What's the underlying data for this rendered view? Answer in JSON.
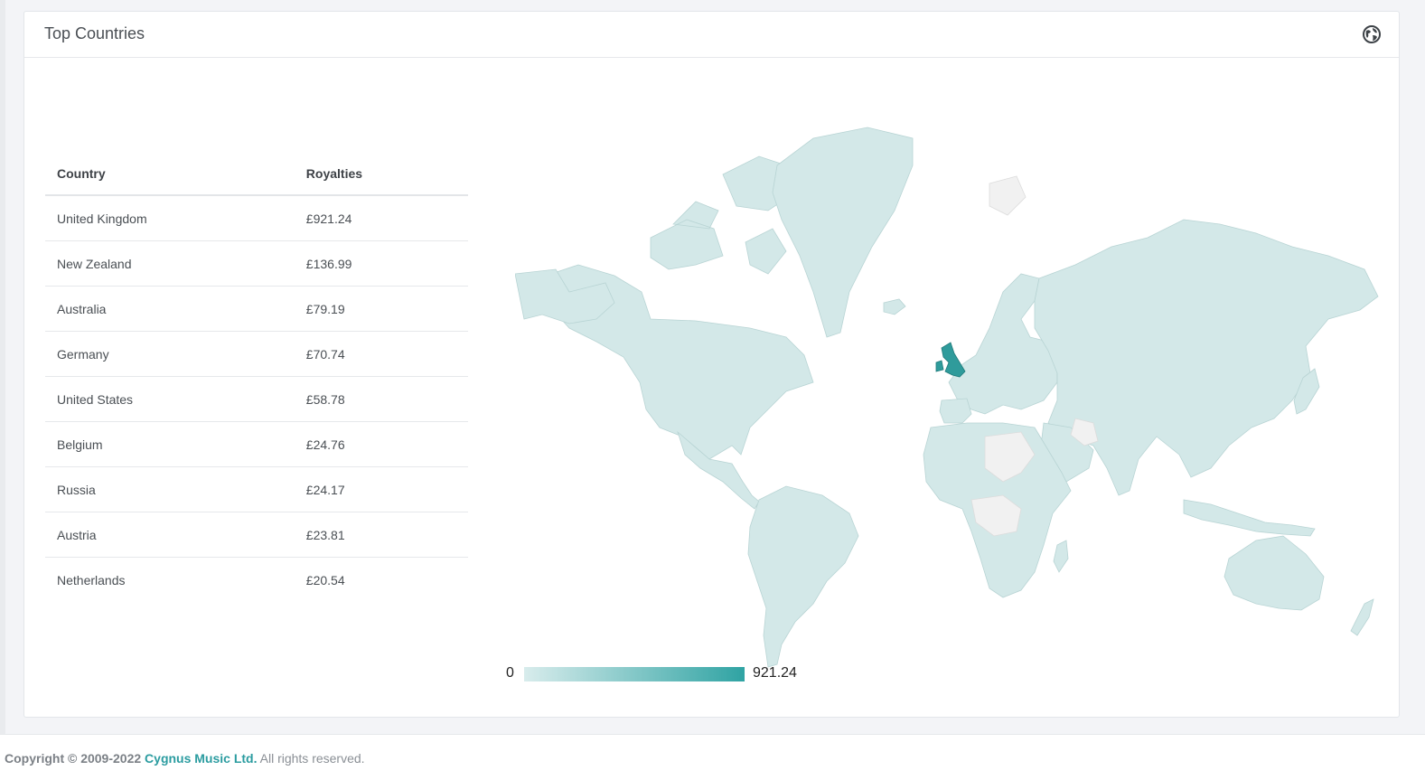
{
  "card": {
    "title": "Top Countries",
    "icon": "globe-icon"
  },
  "table": {
    "headers": [
      "Country",
      "Royalties"
    ],
    "rows": [
      [
        "United Kingdom",
        "£921.24"
      ],
      [
        "New Zealand",
        "£136.99"
      ],
      [
        "Australia",
        "£79.19"
      ],
      [
        "Germany",
        "£70.74"
      ],
      [
        "United States",
        "£58.78"
      ],
      [
        "Belgium",
        "£24.76"
      ],
      [
        "Russia",
        "£24.17"
      ],
      [
        "Austria",
        "£23.81"
      ],
      [
        "Netherlands",
        "£20.54"
      ]
    ]
  },
  "legend": {
    "min": "0",
    "max": "921.24",
    "color_min": "#d8ecec",
    "color_max": "#2fa3a3"
  },
  "footer": {
    "prefix": "Copyright © 2009-2022",
    "brand": "Cygnus Music Ltd.",
    "suffix": "All rights reserved."
  },
  "colors": {
    "accent": "#2b9ca0",
    "map_default": "#d3e8e8",
    "map_nodata": "#f1f1f1",
    "map_highlight": "#2f9b9b"
  }
}
